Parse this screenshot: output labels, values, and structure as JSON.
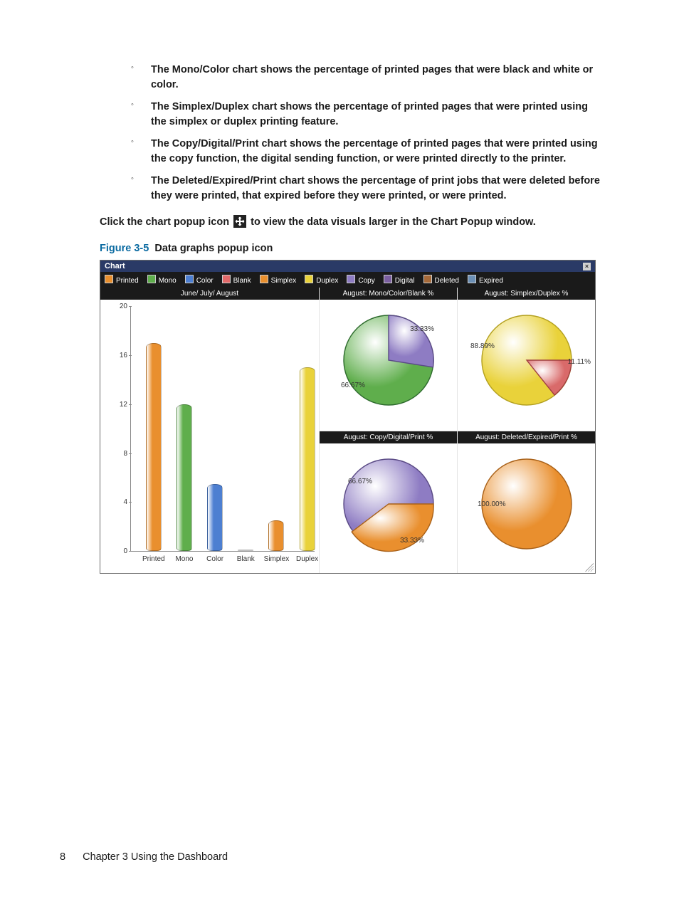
{
  "bullets": [
    "The Mono/Color chart shows the percentage of printed pages that were black and white or color.",
    "The Simplex/Duplex chart shows the percentage of printed pages that were printed using the simplex or duplex printing feature.",
    "The Copy/Digital/Print chart shows the percentage of printed pages that were printed using the copy function, the digital sending function, or were printed directly to the printer.",
    "The Deleted/Expired/Print chart shows the percentage of print jobs that were deleted before they were printed, that expired before they were printed, or were printed."
  ],
  "popup_text_a": "Click the chart popup icon ",
  "popup_text_b": " to view the data visuals larger in the Chart Popup window.",
  "figure": {
    "label": "Figure 3-5",
    "title": "Data graphs popup icon"
  },
  "chart_window": {
    "title": "Chart",
    "legend": [
      {
        "name": "Printed",
        "color": "#e98f2e"
      },
      {
        "name": "Mono",
        "color": "#5fae4c"
      },
      {
        "name": "Color",
        "color": "#4d7fd1"
      },
      {
        "name": "Blank",
        "color": "#e36a6a"
      },
      {
        "name": "Simplex",
        "color": "#e98f2e"
      },
      {
        "name": "Duplex",
        "color": "#e9d23a"
      },
      {
        "name": "Copy",
        "color": "#8e7cc3"
      },
      {
        "name": "Digital",
        "color": "#7b5fa0"
      },
      {
        "name": "Deleted",
        "color": "#a66a3a"
      },
      {
        "name": "Expired",
        "color": "#6b8fb5"
      }
    ],
    "bar_title": "June/ July/ August",
    "pie_titles": [
      "August: Mono/Color/Blank %",
      "August: Simplex/Duplex %",
      "August: Copy/Digital/Print %",
      "August: Deleted/Expired/Print %"
    ],
    "pie_labels": {
      "p1a": "33.33%",
      "p1b": "66.67%",
      "p2a": "88.89%",
      "p2b": "11.11%",
      "p3a": "66.67%",
      "p3b": "33.33%",
      "p4a": "100.00%"
    }
  },
  "footer": {
    "page": "8",
    "chapter": "Chapter 3   Using the Dashboard"
  },
  "chart_data": [
    {
      "type": "bar",
      "title": "June/ July/ August",
      "categories": [
        "Printed",
        "Mono",
        "Color",
        "Blank",
        "Simplex",
        "Duplex"
      ],
      "values": [
        17,
        12,
        5.5,
        0,
        2.5,
        15
      ],
      "colors": [
        "#e98f2e",
        "#5fae4c",
        "#4d7fd1",
        "#e36a6a",
        "#e98f2e",
        "#e9d23a"
      ],
      "xlabel": "",
      "ylabel": "",
      "ylim": [
        0,
        20
      ],
      "yticks": [
        0,
        4,
        8,
        12,
        16,
        20
      ]
    },
    {
      "type": "pie",
      "title": "August: Mono/Color/Blank %",
      "series": [
        {
          "name": "Mono",
          "value": 66.67,
          "color": "#5fae4c",
          "label": "66.67%"
        },
        {
          "name": "Color",
          "value": 33.33,
          "color": "#8e7cc3",
          "label": "33.33%"
        }
      ]
    },
    {
      "type": "pie",
      "title": "August: Simplex/Duplex %",
      "series": [
        {
          "name": "Simplex",
          "value": 88.89,
          "color": "#e9d23a",
          "label": "88.89%"
        },
        {
          "name": "Duplex",
          "value": 11.11,
          "color": "#d96a6a",
          "label": "11.11%"
        }
      ]
    },
    {
      "type": "pie",
      "title": "August: Copy/Digital/Print %",
      "series": [
        {
          "name": "Copy",
          "value": 66.67,
          "color": "#8e7cc3",
          "label": "66.67%"
        },
        {
          "name": "Print",
          "value": 33.33,
          "color": "#e98f2e",
          "label": "33.33%"
        }
      ]
    },
    {
      "type": "pie",
      "title": "August: Deleted/Expired/Print %",
      "series": [
        {
          "name": "Print",
          "value": 100.0,
          "color": "#e98f2e",
          "label": "100.00%"
        }
      ]
    }
  ]
}
